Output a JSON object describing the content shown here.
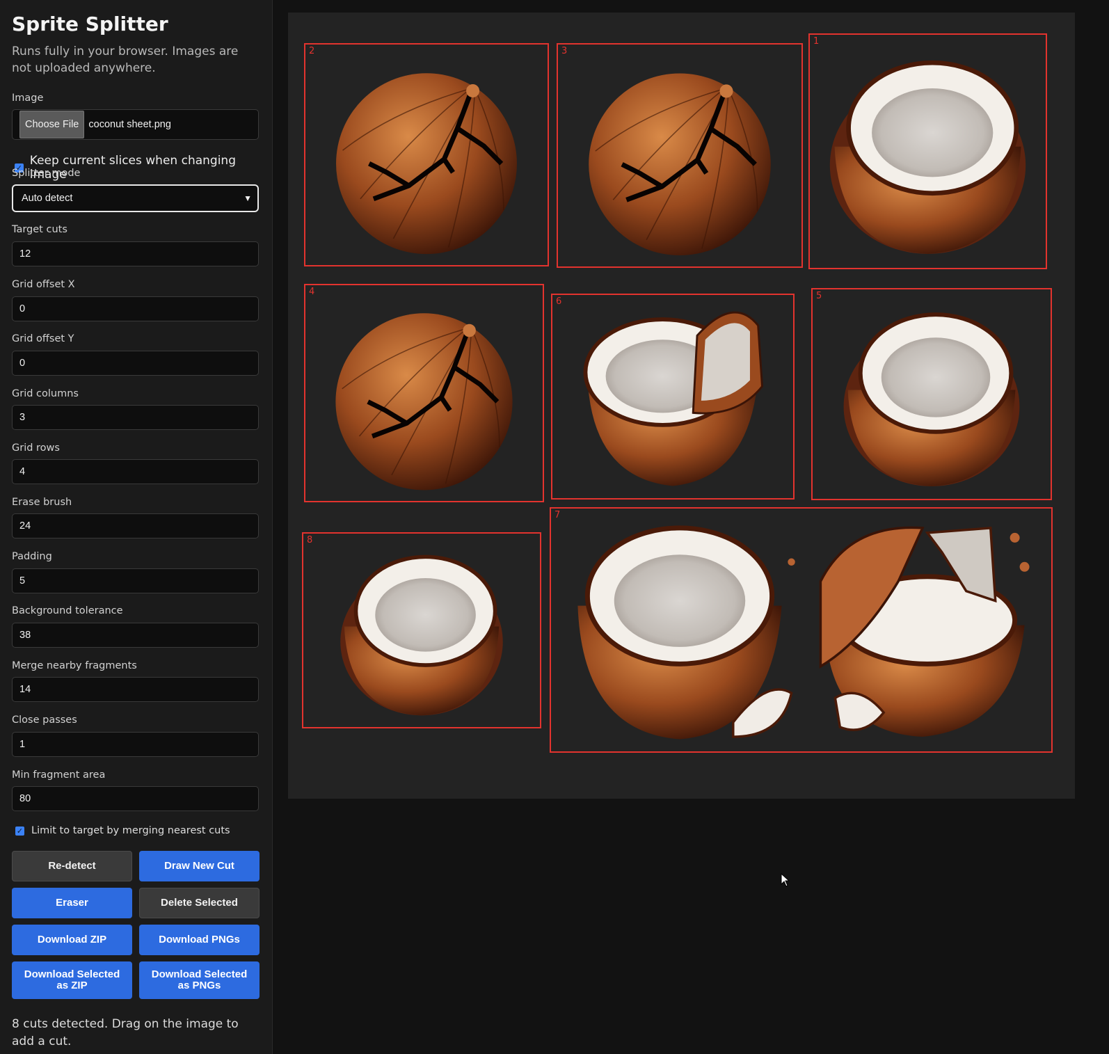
{
  "app": {
    "title": "Sprite Splitter",
    "subtitle": "Runs fully in your browser. Images are not uploaded anywhere."
  },
  "image": {
    "label": "Image",
    "choose_button": "Choose File",
    "filename": "coconut sheet.png"
  },
  "keep_slices": {
    "label": "Keep current slices when changing image",
    "checked": true
  },
  "splitter_mode": {
    "label": "Splitter mode",
    "value": "Auto detect"
  },
  "fields": {
    "target_cuts": {
      "label": "Target cuts",
      "value": "12"
    },
    "grid_offset_x": {
      "label": "Grid offset X",
      "value": "0"
    },
    "grid_offset_y": {
      "label": "Grid offset Y",
      "value": "0"
    },
    "grid_columns": {
      "label": "Grid columns",
      "value": "3"
    },
    "grid_rows": {
      "label": "Grid rows",
      "value": "4"
    },
    "erase_brush": {
      "label": "Erase brush",
      "value": "24"
    },
    "padding": {
      "label": "Padding",
      "value": "5"
    },
    "background_tolerance": {
      "label": "Background tolerance",
      "value": "38"
    },
    "merge_nearby": {
      "label": "Merge nearby fragments",
      "value": "14"
    },
    "close_passes": {
      "label": "Close passes",
      "value": "1"
    },
    "min_fragment_area": {
      "label": "Min fragment area",
      "value": "80"
    }
  },
  "limit_target": {
    "label": "Limit to target by merging nearest cuts",
    "checked": true
  },
  "buttons": {
    "redetect": "Re-detect",
    "draw_new_cut": "Draw New Cut",
    "eraser": "Eraser",
    "delete_selected": "Delete Selected",
    "download_zip": "Download ZIP",
    "download_pngs": "Download PNGs",
    "download_selected_zip": "Download Selected as ZIP",
    "download_selected_pngs": "Download Selected as PNGs"
  },
  "status": "8 cuts detected. Drag on the image to add a cut.",
  "cuts": [
    {
      "id": "2",
      "sprite": "whole-cracked-coconut"
    },
    {
      "id": "3",
      "sprite": "whole-cracked-coconut"
    },
    {
      "id": "1",
      "sprite": "half-coconut"
    },
    {
      "id": "4",
      "sprite": "whole-cracked-coconut"
    },
    {
      "id": "6",
      "sprite": "broken-coconut"
    },
    {
      "id": "5",
      "sprite": "half-coconut"
    },
    {
      "id": "8",
      "sprite": "half-coconut"
    },
    {
      "id": "7",
      "sprite": "shattered-coconuts"
    }
  ],
  "colors": {
    "accent": "#2d6be0",
    "cut_outline": "#e3332e",
    "canvas_bg": "#232323",
    "sidebar_bg": "#1b1b1b"
  }
}
